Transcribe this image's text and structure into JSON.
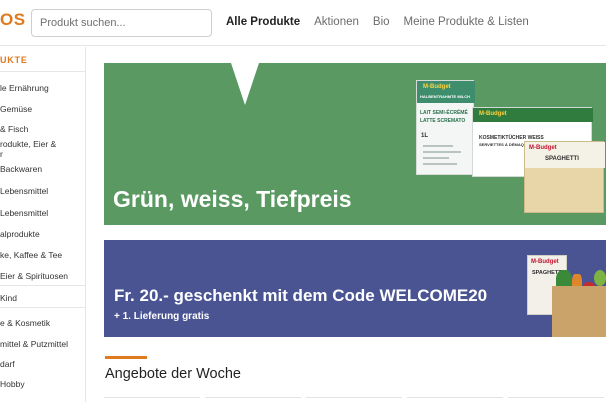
{
  "header": {
    "logo_text": "OS",
    "search_placeholder": "Produkt suchen...",
    "nav": [
      {
        "label": "Alle Produkte",
        "active": true
      },
      {
        "label": "Aktionen",
        "active": false
      },
      {
        "label": "Bio",
        "active": false
      },
      {
        "label": "Meine Produkte & Listen",
        "active": false
      }
    ]
  },
  "sidebar": {
    "title": "UKTE",
    "items": [
      {
        "label": "le Ernährung"
      },
      {
        "label": "Gemüse"
      },
      {
        "label": "& Fisch"
      },
      {
        "label": "rodukte, Eier &"
      },
      {
        "label": "r"
      },
      {
        "label": "Backwaren"
      },
      {
        "label": "Lebensmittel"
      },
      {
        "label": "Lebensmittel"
      },
      {
        "label": "alprodukte"
      },
      {
        "label": "ke, Kaffee & Tee"
      },
      {
        "label": "Eier & Spirituosen"
      },
      {
        "label": "Kind"
      },
      {
        "label": "e & Kosmetik"
      },
      {
        "label": "mittel & Putzmittel"
      },
      {
        "label": "darf"
      },
      {
        "label": "Hobby"
      }
    ]
  },
  "banners": {
    "first": {
      "headline": "Grün, weiss, Tiefpreis",
      "background": "#5a9a62",
      "milk_text_1": "HALBENTRAHMTE MILCH",
      "milk_text_2": "LAIT SEMI-ÉCRÉMÉ",
      "milk_text_3": "LATTE SCREMATO",
      "milk_volume": "1L",
      "tissue_text_1": "KOSMETIKTÜCHER WEISS",
      "tissue_text_2": "SERVIETTES À DÉMAQUILLER BLANCHES",
      "pasta_text": "SPAGHETTI",
      "brand": "M-Budget"
    },
    "second": {
      "headline": "Fr. 20.- geschenkt mit dem Code WELCOME20",
      "subline": "+ 1. Lieferung gratis",
      "background": "#4a5493",
      "pack_text": "SPAGHETTI",
      "brand": "M-Budget"
    }
  },
  "section": {
    "title": "Angebote der Woche",
    "accent_color": "#e07a1f"
  },
  "colors": {
    "brand_orange": "#e07a1f",
    "nav_active": "#222222",
    "nav_inactive": "#6b6b6b"
  }
}
